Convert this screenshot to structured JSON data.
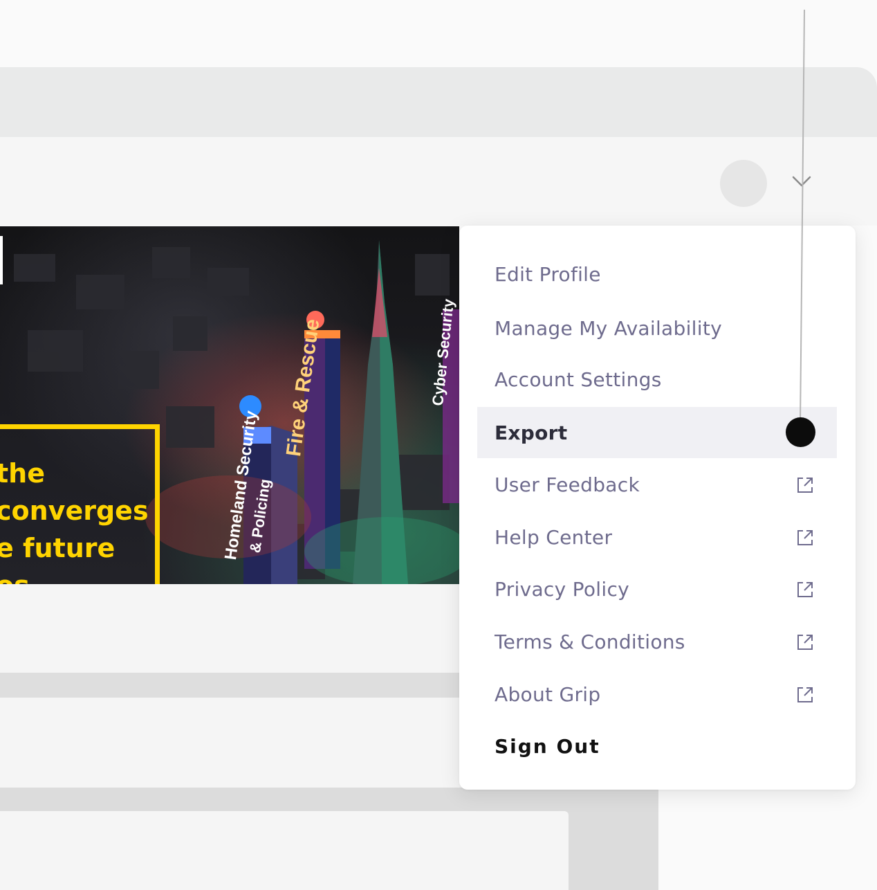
{
  "banner": {
    "headline_lines": [
      "the",
      "converges",
      "e future",
      "os"
    ],
    "tower_labels": {
      "homeland_line1": "Homeland Security",
      "homeland_line2": "& Policing",
      "fire": "Fire & Rescue",
      "cyber": "Cyber Security"
    }
  },
  "header": {
    "avatar": "user-avatar",
    "dropdown_icon": "chevron-down-icon"
  },
  "menu": {
    "items": [
      {
        "label": "Edit Profile",
        "icon": ""
      },
      {
        "label": "Manage My Availability",
        "icon": ""
      },
      {
        "label": "Account Settings",
        "icon": ""
      },
      {
        "label": "Export",
        "icon": "",
        "active": true
      },
      {
        "label": "User Feedback",
        "icon": "external-link-icon"
      },
      {
        "label": "Help Center",
        "icon": "external-link-icon"
      },
      {
        "label": "Privacy Policy",
        "icon": "external-link-icon"
      },
      {
        "label": "Terms & Conditions",
        "icon": "external-link-icon"
      },
      {
        "label": "About Grip",
        "icon": "external-link-icon"
      },
      {
        "label": "Sign Out",
        "icon": ""
      }
    ]
  },
  "colors": {
    "accent_yellow": "#ffd400",
    "menu_text": "#6e6b8d",
    "active_bg": "#f0f0f4"
  }
}
